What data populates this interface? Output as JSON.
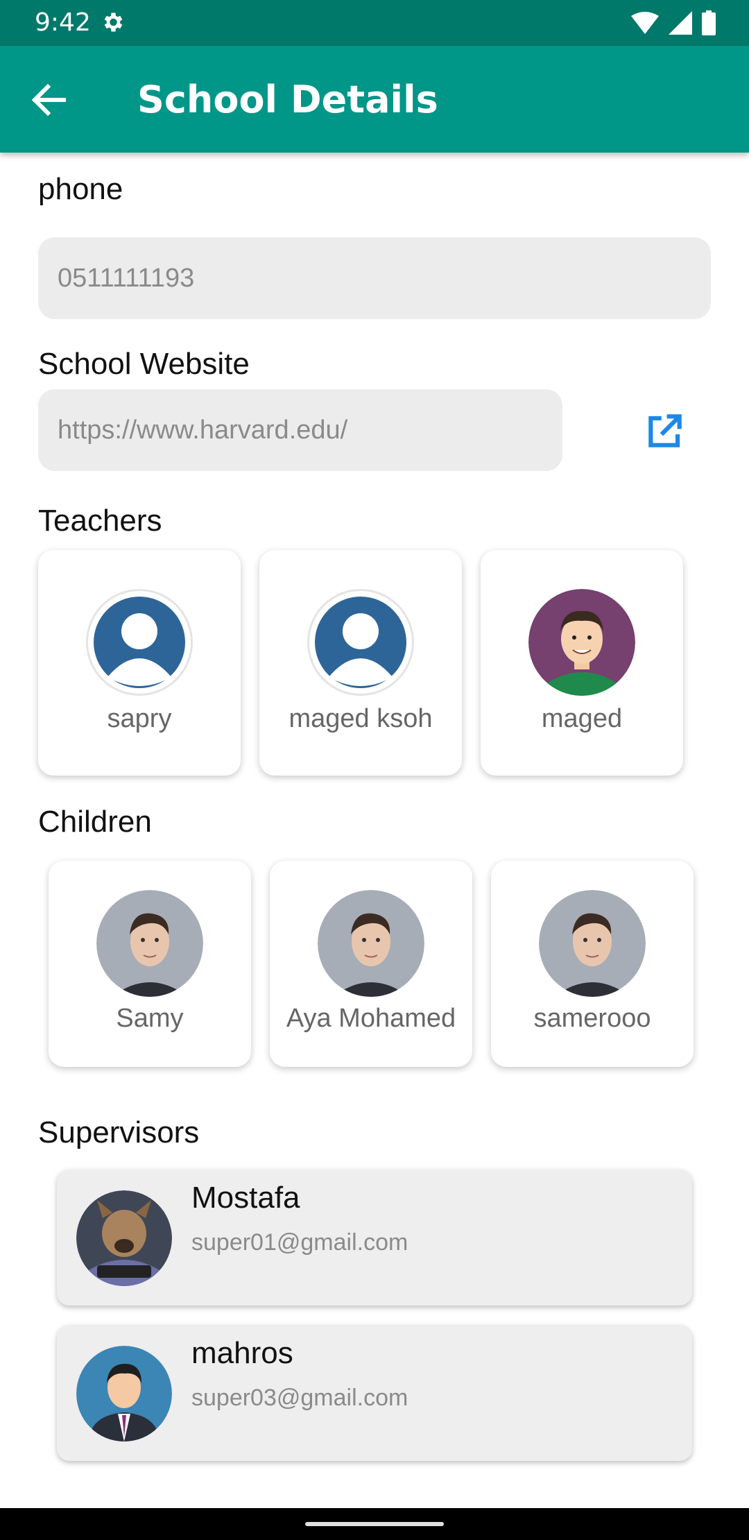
{
  "status_bar": {
    "time": "9:42"
  },
  "app_bar": {
    "title": "School Details"
  },
  "phone": {
    "label": "phone",
    "value": "0511111193"
  },
  "website": {
    "label": "School Website",
    "value": "https://www.harvard.edu/"
  },
  "teachers": {
    "label": "Teachers",
    "items": [
      {
        "name": "sapry",
        "avatar": "default-user-avatar"
      },
      {
        "name": "maged ksoh",
        "avatar": "default-user-avatar"
      },
      {
        "name": "maged",
        "avatar": "cartoon-man-avatar"
      }
    ]
  },
  "children": {
    "label": "Children",
    "items": [
      {
        "name": "Samy",
        "avatar": "young-man-photo"
      },
      {
        "name": "Aya Mohamed",
        "avatar": "young-man-photo"
      },
      {
        "name": "samerooo",
        "avatar": "young-man-photo"
      }
    ]
  },
  "supervisors": {
    "label": "Supervisors",
    "items": [
      {
        "name": "Mostafa",
        "email": "super01@gmail.com",
        "avatar": "dog-at-laptop-photo"
      },
      {
        "name": "mahros",
        "email": "super03@gmail.com",
        "avatar": "businessman-avatar"
      }
    ]
  },
  "colors": {
    "status_bar": "#00796b",
    "app_bar": "#009688",
    "link_icon": "#1e88e5",
    "default_avatar": "#2e6599"
  }
}
